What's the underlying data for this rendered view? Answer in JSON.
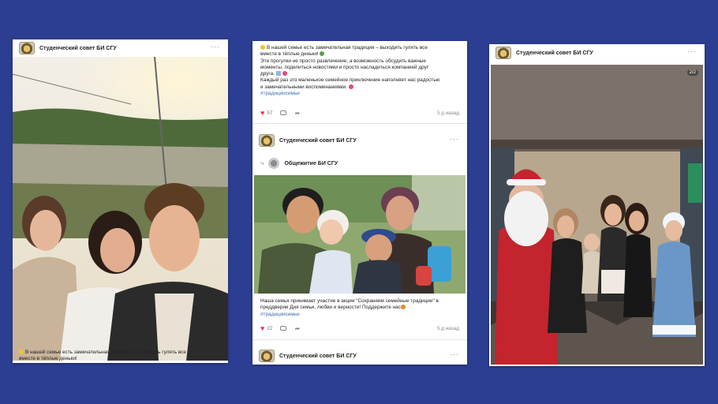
{
  "cards": [
    {
      "author": "Студенческий совет БИ СГУ",
      "more": "···",
      "caption_line1": "В нашей семье есть замечательная традиция – выходить гулять все",
      "caption_line2": "вместе в тёплые деньки!"
    },
    {
      "top_post": {
        "line1": "В нашей семье есть замечательная традиция – выходить гулять все",
        "line2": "вместе в тёплые деньки!",
        "line3": "Эти прогулки не просто развлечение, а возможность обсудить важные",
        "line4": "моменты, поделиться новостями и просто насладиться компанией друг",
        "line5": "друга.",
        "line6": "Каждый раз это маленькое семейное приключение наполняет нас радостью",
        "line7": "и замечательными воспоминаниями.",
        "hashtag": "#традициисемьи",
        "likes": "57",
        "date": "5 д назад"
      },
      "second_post": {
        "author": "Студенческий совет БИ СГУ",
        "more": "···",
        "repost_author": "Общежитие БИ СГУ",
        "line1": "Наша семья принимает участие в акции \"Сохраняем семейные традиции\" в",
        "line2": "преддверии Дня семьи, любви и верности! Поддержите нас",
        "hashtag": "#традициисемьи",
        "likes": "22",
        "date": "5 д назад"
      },
      "third_post": {
        "author": "Студенческий совет БИ СГУ",
        "more": "···"
      }
    },
    {
      "author": "Студенческий совет БИ СГУ",
      "more": "···",
      "photo_counter": "2/2"
    }
  ],
  "colors": {
    "background": "#2c3e91",
    "like": "#e3344f",
    "hashtag": "#3a6bb0"
  }
}
